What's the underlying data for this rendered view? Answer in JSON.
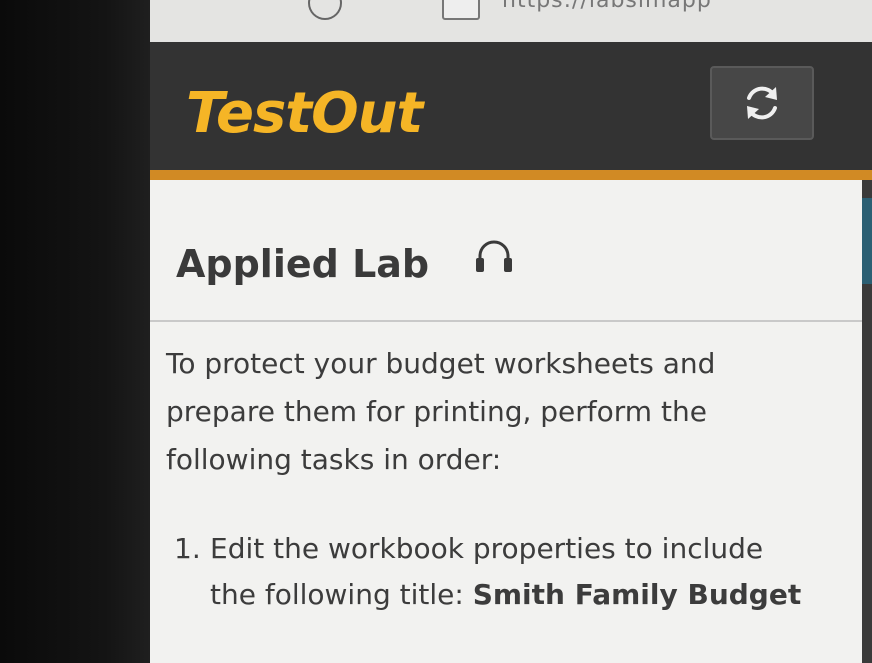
{
  "browser": {
    "url": "https://labsimapp"
  },
  "header": {
    "logo": "TestOut",
    "refresh_icon": "refresh-icon",
    "background": "#333333",
    "accent": "#d18a24",
    "logo_color": "#f5b526"
  },
  "lab": {
    "title": "Applied Lab",
    "audio_icon": "headphones-icon",
    "intro": "To protect your budget worksheets and prepare them for printing, perform the following tasks in order:",
    "tasks": [
      {
        "number": "1.",
        "text": "Edit the workbook properties to include the following title: ",
        "bold": "Smith Family Budget"
      }
    ]
  }
}
